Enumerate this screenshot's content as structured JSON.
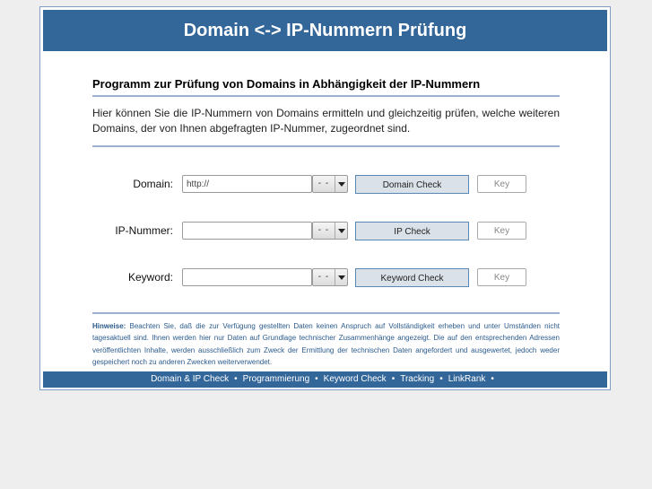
{
  "header": {
    "title": "Domain <-> IP-Nummern Prüfung"
  },
  "main": {
    "subtitle": "Programm zur Prüfung von Domains in Abhängigkeit der IP-Nummern",
    "intro": "Hier können Sie die IP-Nummern von Domains ermitteln und gleichzeitig prüfen, welche weiteren Domains, der von Ihnen abgefragten IP-Nummer, zugeordnet sind."
  },
  "form": {
    "rows": [
      {
        "label": "Domain:",
        "value": "http://",
        "placeholder": "",
        "select_value": "- -",
        "check_button": "Domain Check",
        "key_button": "Key"
      },
      {
        "label": "IP-Nummer:",
        "value": "",
        "placeholder": "",
        "select_value": "- -",
        "check_button": "IP Check",
        "key_button": "Key"
      },
      {
        "label": "Keyword:",
        "value": "",
        "placeholder": "",
        "select_value": "- -",
        "check_button": "Keyword Check",
        "key_button": "Key"
      }
    ]
  },
  "notes": {
    "label": "Hinweise:",
    "text": " Beachten Sie, daß die zur Verfügung gestellten Daten keinen Anspruch auf Vollständigkeit erheben und unter Umständen nicht tagesaktuell sind. Ihnen werden hier nur Daten auf Grundlage technischer Zusammenhänge angezeigt. Die auf den entsprechenden Adressen veröffentlichten Inhalte, werden ausschließlich zum Zweck der Ermittlung der technischen Daten angefordert und ausgewertet, jedoch weder gespeichert noch zu anderen Zwecken weiterverwendet."
  },
  "footer": {
    "links": [
      "Domain & IP Check",
      "Programmierung",
      "Keyword Check",
      "Tracking",
      "LinkRank"
    ],
    "separator": "•"
  },
  "colors": {
    "brand_blue": "#336699",
    "rule_blue": "#9bb3cf",
    "notes_text": "#2b5b8c",
    "button_bg": "#dae1e8"
  }
}
